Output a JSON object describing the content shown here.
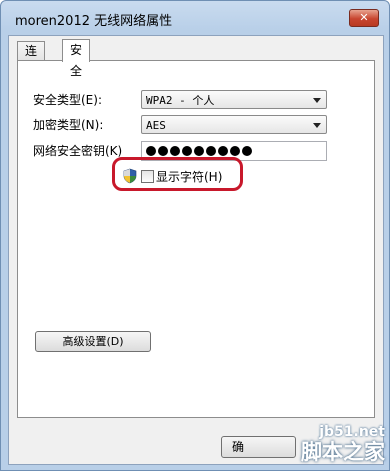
{
  "window": {
    "title": "moren2012 无线网络属性",
    "close_label": "✕"
  },
  "tabs": [
    {
      "label": "连接"
    },
    {
      "label": "安全"
    }
  ],
  "security": {
    "type_label": "安全类型(E):",
    "type_value": "WPA2 - 个人",
    "encryption_label": "加密类型(N):",
    "encryption_value": "AES",
    "key_label": "网络安全密钥(K)",
    "key_mask_count": 9,
    "show_chars_label": "显示字符(H)",
    "show_chars_checked": false
  },
  "buttons": {
    "advanced": "高级设置(D)",
    "ok": "确"
  },
  "watermark": {
    "url": "jb51.net",
    "text": "脚本之家"
  },
  "colors": {
    "highlight": "#c8182b",
    "titlebar": "#b8cfe8"
  }
}
